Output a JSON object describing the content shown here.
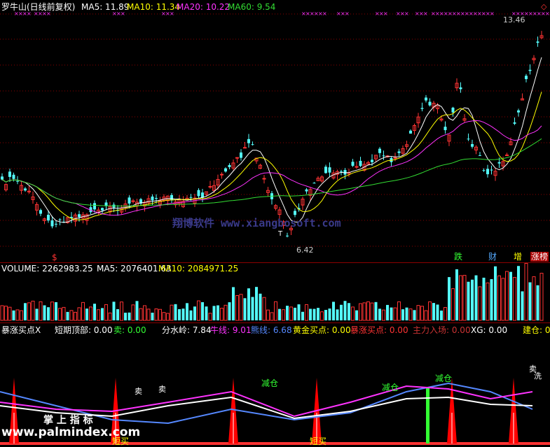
{
  "main_panel": {
    "title": "罗牛山(日线前复权)",
    "ma": [
      {
        "label": "MA5: 11.89",
        "color": "#ffffff"
      },
      {
        "label": "MA10: 11.34",
        "color": "#ffff00"
      },
      {
        "label": "MA20: 10.22",
        "color": "#ff33ff"
      },
      {
        "label": "MA60: 9.54",
        "color": "#33dd33"
      }
    ],
    "high_label": "13.46",
    "low_label": "6.42",
    "watermark": "翔博软件 www.xiangbosoft.com",
    "markers": {
      "dollar": "$",
      "t": "T"
    },
    "tags": [
      {
        "text": "跌",
        "color": "#33ff33",
        "bg": "#000000"
      },
      {
        "text": "财",
        "color": "#55aaff",
        "bg": "#000000"
      },
      {
        "text": "增",
        "color": "#ffff00",
        "bg": "#000000"
      },
      {
        "text": "涨榜",
        "color": "#ffffff",
        "bg": "#aa0000"
      }
    ]
  },
  "volume_panel": {
    "label": "VOLUME: 2262983.25",
    "ma5": "MA5: 2076401.63",
    "ma10": "MA10: 2084971.25"
  },
  "indicator_panel": {
    "name": "暴涨买点X",
    "items": [
      {
        "text": "短期顶部: 0.00",
        "color": "#ffffff"
      },
      {
        "text": "卖: 0.00",
        "color": "#33ff33"
      },
      {
        "text": "分水岭: 7.84",
        "color": "#ffffff"
      },
      {
        "text": "牛线: 9.01",
        "color": "#ff33ff"
      },
      {
        "text": "熊线: 6.68",
        "color": "#5588ff"
      },
      {
        "text": "黄金买点: 0.00",
        "color": "#ffff00"
      },
      {
        "text": "暴涨买点: 0.00",
        "color": "#ff3333"
      },
      {
        "text": "主力入场: 0.00",
        "color": "#cc3333"
      },
      {
        "text": "XG: 0.00",
        "color": "#ffffff"
      },
      {
        "text": "建仓: 0.0",
        "color": "#ffff00"
      }
    ],
    "signals": {
      "jiancang": "减仓",
      "sell": "卖",
      "shortbuy": "短买",
      "xi": "洗"
    },
    "watermark1": "掌 上 指 标",
    "watermark2": "www.palmindex.com"
  },
  "colors": {
    "up": "#ff3333",
    "down": "#54fcfc",
    "grid": "#8b0000",
    "ma5": "#ffffff",
    "ma10": "#ffff00",
    "ma20": "#ff33ff",
    "ma60": "#33dd33"
  }
}
